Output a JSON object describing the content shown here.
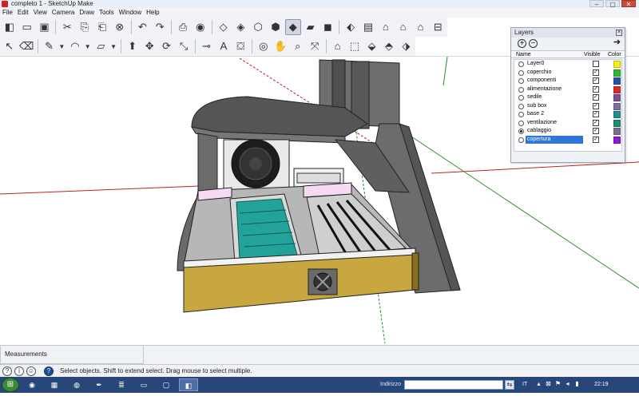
{
  "window": {
    "title": "completo 1 - SketchUp Make",
    "min": "–",
    "max": "▢",
    "close": "✕"
  },
  "menu": [
    "File",
    "Edit",
    "View",
    "Camera",
    "Draw",
    "Tools",
    "Window",
    "Help"
  ],
  "toolbar1": [
    {
      "icon": "new-file-icon",
      "glyph": "◧"
    },
    {
      "icon": "open-folder-icon",
      "glyph": "▭"
    },
    {
      "icon": "save-icon",
      "glyph": "▣"
    },
    {
      "icon": "cut-icon",
      "glyph": "✂"
    },
    {
      "icon": "copy-icon",
      "glyph": "⎘"
    },
    {
      "icon": "paste-icon",
      "glyph": "⎗"
    },
    {
      "icon": "erase-icon",
      "glyph": "⊗"
    },
    {
      "icon": "undo-icon",
      "glyph": "↶"
    },
    {
      "icon": "redo-icon",
      "glyph": "↷"
    },
    {
      "icon": "print-icon",
      "glyph": "⎙"
    },
    {
      "icon": "model-info-icon",
      "glyph": "◉"
    },
    {
      "icon": "xray-icon",
      "glyph": "◇"
    },
    {
      "icon": "back-edges-icon",
      "glyph": "◈"
    },
    {
      "icon": "wireframe-icon",
      "glyph": "⬡"
    },
    {
      "icon": "hidden-line-icon",
      "glyph": "⬢"
    },
    {
      "icon": "shaded-icon",
      "glyph": "◆"
    },
    {
      "icon": "shaded-textures-icon",
      "glyph": "▰"
    },
    {
      "icon": "monochrome-icon",
      "glyph": "◼"
    },
    {
      "icon": "iso-view-icon",
      "glyph": "⬖"
    },
    {
      "icon": "top-view-icon",
      "glyph": "▤"
    },
    {
      "icon": "front-view-icon",
      "glyph": "⌂"
    },
    {
      "icon": "right-view-icon",
      "glyph": "⌂"
    },
    {
      "icon": "back-view-icon",
      "glyph": "⌂"
    },
    {
      "icon": "left-view-icon",
      "glyph": "⊟"
    }
  ],
  "toolbar2": [
    {
      "icon": "select-arrow-icon",
      "glyph": "↖"
    },
    {
      "icon": "eraser-icon",
      "glyph": "⌫"
    },
    {
      "icon": "pencil-line-icon",
      "glyph": "✎"
    },
    {
      "icon": "arc-icon",
      "glyph": "◠"
    },
    {
      "icon": "rectangle-icon",
      "glyph": "▱"
    },
    {
      "icon": "push-pull-icon",
      "glyph": "⬆"
    },
    {
      "icon": "move-icon",
      "glyph": "✥"
    },
    {
      "icon": "rotate-icon",
      "glyph": "⟳"
    },
    {
      "icon": "scale-icon",
      "glyph": "⤡"
    },
    {
      "icon": "tape-measure-icon",
      "glyph": "⊸"
    },
    {
      "icon": "text-icon",
      "glyph": "A"
    },
    {
      "icon": "paint-bucket-icon",
      "glyph": "⛋"
    },
    {
      "icon": "orbit-icon",
      "glyph": "◎"
    },
    {
      "icon": "pan-hand-icon",
      "glyph": "✋"
    },
    {
      "icon": "zoom-icon",
      "glyph": "⌕"
    },
    {
      "icon": "zoom-extents-icon",
      "glyph": "⤧"
    },
    {
      "icon": "3d-warehouse-icon",
      "glyph": "⌂"
    },
    {
      "icon": "get-models-icon",
      "glyph": "⬚"
    },
    {
      "icon": "share-model-icon",
      "glyph": "⬙"
    },
    {
      "icon": "extension-icon",
      "glyph": "⬘"
    },
    {
      "icon": "components-icon",
      "glyph": "⬗"
    }
  ],
  "layers": {
    "title": "Layers",
    "col_name": "Name",
    "col_visible": "Visible",
    "col_color": "Color",
    "items": [
      {
        "name": "Layer0",
        "active": false,
        "visible": false,
        "color": "#f2ee1a",
        "selected": false
      },
      {
        "name": "coperchio",
        "active": false,
        "visible": true,
        "color": "#2eb82e",
        "selected": false
      },
      {
        "name": "componenti",
        "active": false,
        "visible": true,
        "color": "#2a4fa8",
        "selected": false
      },
      {
        "name": "alimentazione",
        "active": false,
        "visible": true,
        "color": "#d92a2a",
        "selected": false
      },
      {
        "name": "sedile",
        "active": false,
        "visible": true,
        "color": "#7d4d94",
        "selected": false
      },
      {
        "name": "sub box",
        "active": false,
        "visible": true,
        "color": "#7b6fa8",
        "selected": false
      },
      {
        "name": "base 2",
        "active": false,
        "visible": true,
        "color": "#1e8f8f",
        "selected": false
      },
      {
        "name": "ventilazione",
        "active": false,
        "visible": true,
        "color": "#1c8c72",
        "selected": false
      },
      {
        "name": "cablaggio",
        "active": true,
        "visible": true,
        "color": "#7d6e8f",
        "selected": false
      },
      {
        "name": "copertura",
        "active": false,
        "visible": true,
        "color": "#8a1ad9",
        "selected": true
      }
    ]
  },
  "measurements": {
    "label": "Measurements"
  },
  "status": {
    "message": "Select objects. Shift to extend select. Drag mouse to select multiple."
  },
  "taskbar": {
    "address_label": "Indirizzo",
    "address_value": "",
    "lang": "IT",
    "clock": "22:19"
  }
}
